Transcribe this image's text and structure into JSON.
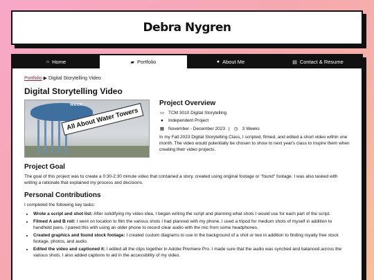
{
  "site": {
    "title": "Debra Nygren"
  },
  "nav": [
    {
      "label": "Home",
      "icon": "home-icon"
    },
    {
      "label": "Portfolio",
      "icon": "folder-icon"
    },
    {
      "label": "About Me",
      "icon": "user-icon"
    },
    {
      "label": "Contact & Resume",
      "icon": "document-icon"
    }
  ],
  "breadcrumb": {
    "link": "Portfolio",
    "separator": "▶",
    "current": "Digital Storytelling Video"
  },
  "page": {
    "title": "Digital Storytelling Video"
  },
  "hero": {
    "overlay_text": "All About Water Towers",
    "tower_text": "WAUK..."
  },
  "overview": {
    "heading": "Project Overview",
    "course": "TCM 3010 Digital Storytelling",
    "type": "Independent Project",
    "dates": "November - December 2023",
    "duration": "3 Weeks",
    "description": "In my Fall 2023 Digital Storytelling Class, I scripted, filmed, and edited a short video within one month. The video would potentially be chosen to show to next year's class to inspire them when creating their video projects."
  },
  "goal": {
    "heading": "Project Goal",
    "text": "The goal of this project was to create a 0:30-2:30 minute video that contained a story, created using original footage or \"found\" footage. I was also tasked with writing a rationale that explained my process and decisions."
  },
  "contributions": {
    "heading": "Personal Contributions",
    "intro": "I completed the following key tasks:",
    "items": [
      {
        "title": "Wrote a script and shot list:",
        "text": "After solidifying my video idea, I began writing the script and planning what shots I would use for each part of the script."
      },
      {
        "title": "Filmed A and B roll:",
        "text": "I went on location to film the various shots I had planned with my phone. I used a tripod for medium shots of myself in addition to handheld pans. I paired this with using an older phone to record clear audio with the mic from some headphones."
      },
      {
        "title": "Created graphics and found stock footage:",
        "text": "I created custom diagrams to use in the background of a shot or two in addition to finding royalty free stock footage, photos, and audio."
      },
      {
        "title": "Edited the video and captioned it:",
        "text": "I edited all the clips together in Adobe Premiere Pro. I made sure that the audio was synched and balanced across the various shots. I also added captions to aid in the accessibility of my video."
      }
    ]
  }
}
